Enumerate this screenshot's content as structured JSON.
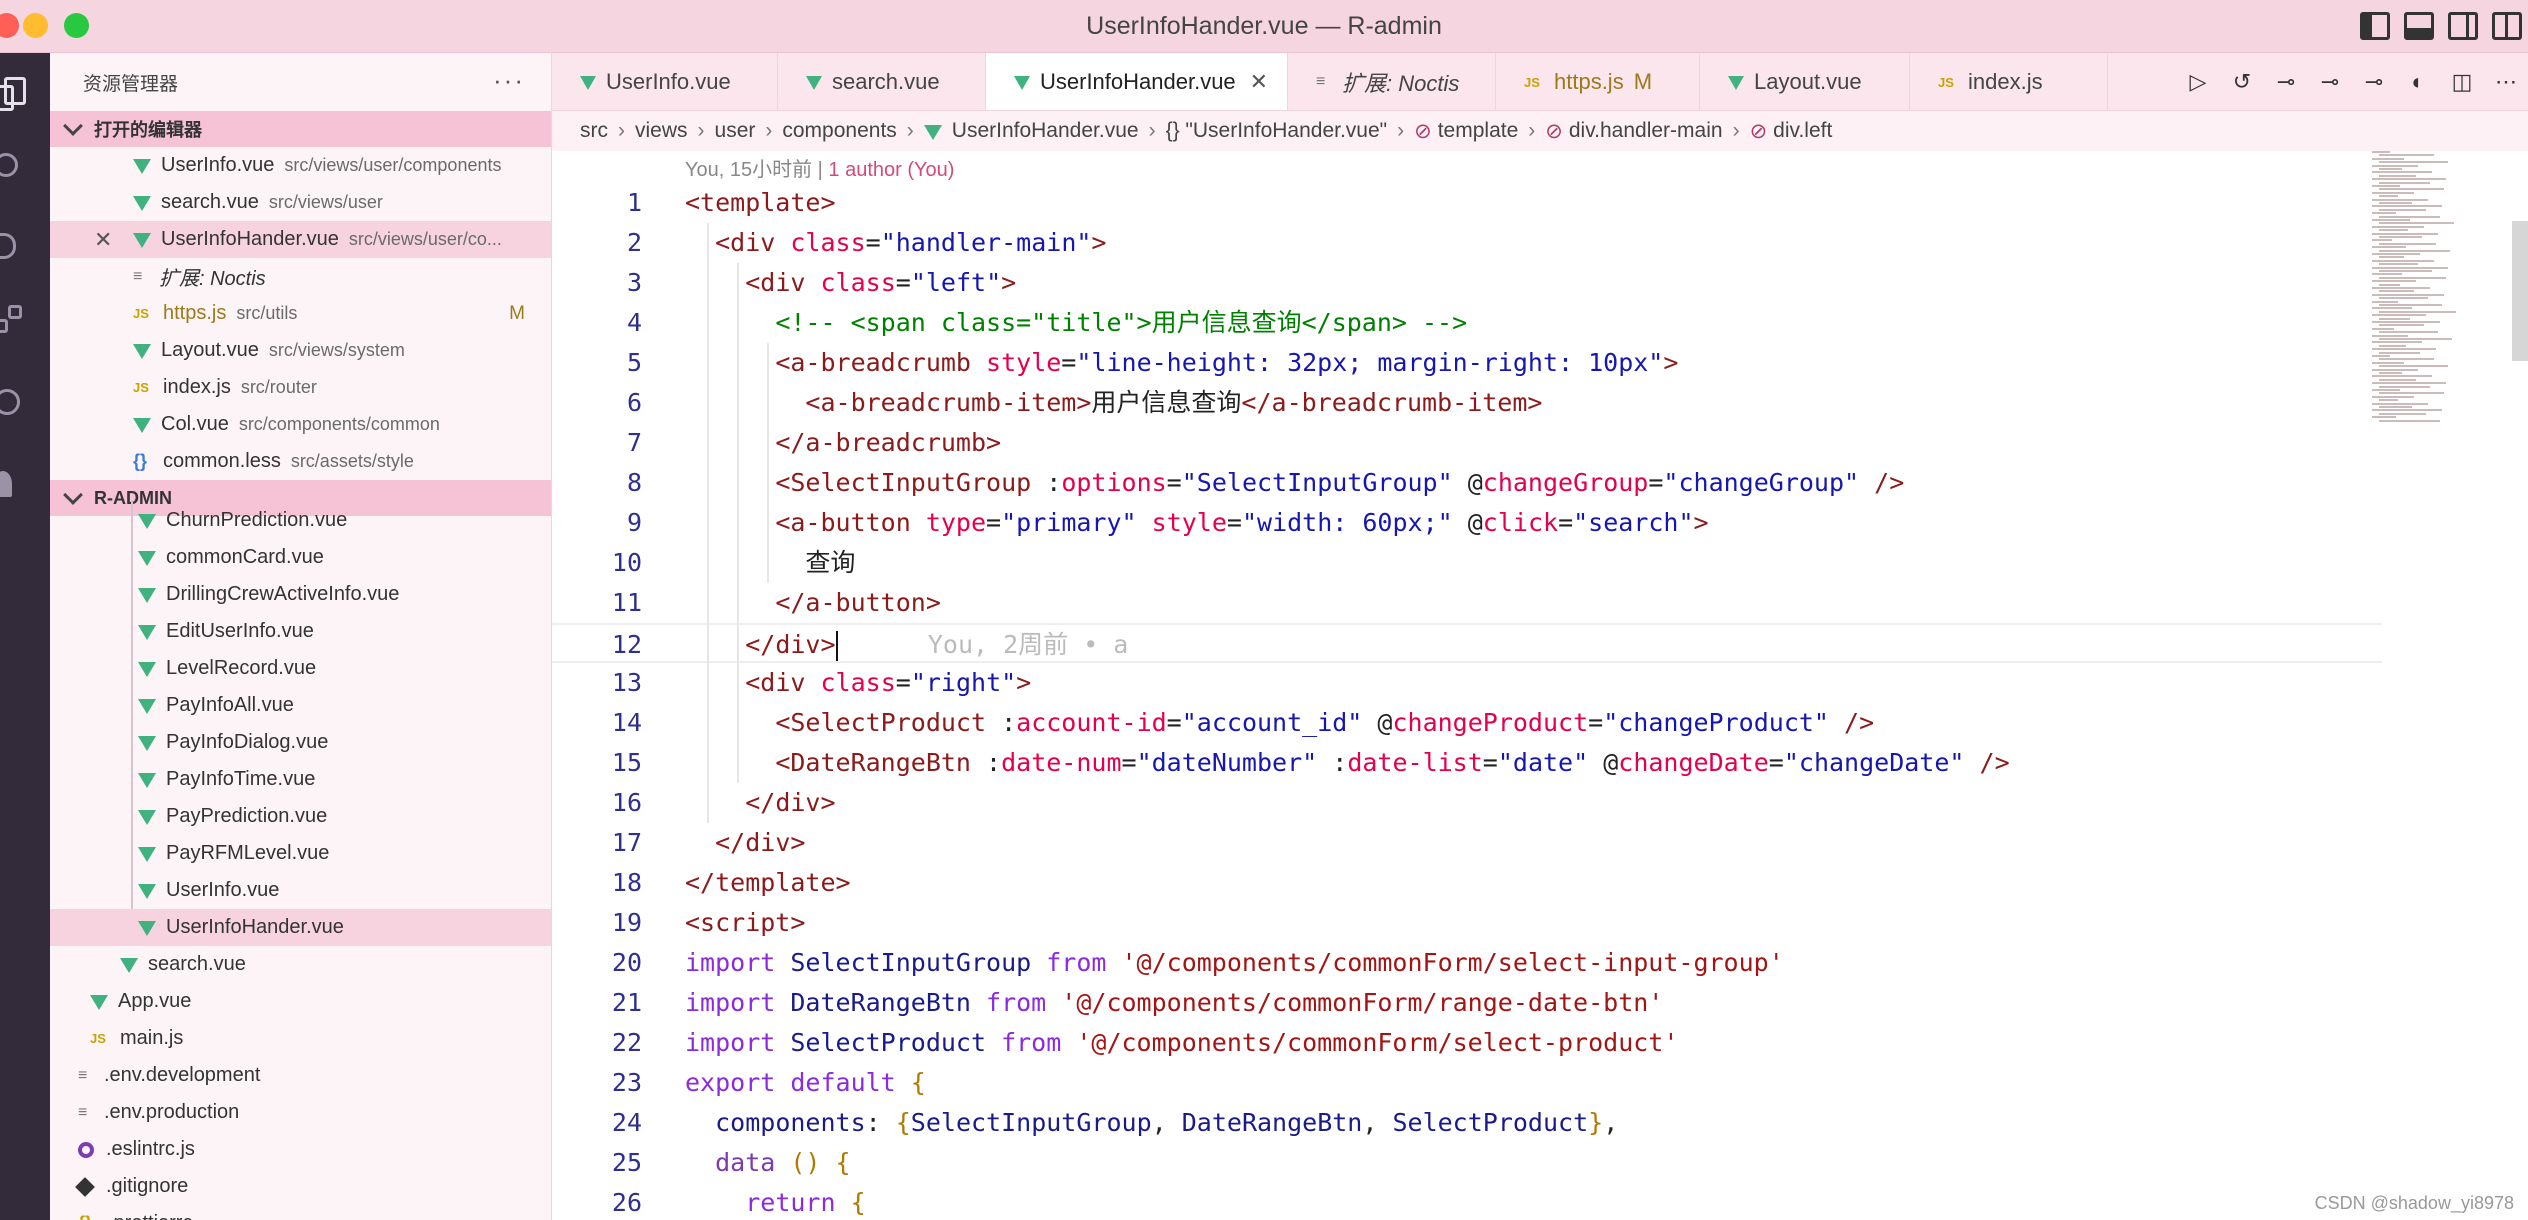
{
  "window": {
    "title": "UserInfoHander.vue — R-admin"
  },
  "sidebar": {
    "title": "资源管理器",
    "more": "···",
    "open_editors_header": "打开的编辑器",
    "open_editors": [
      {
        "name": "UserInfo.vue",
        "path": "src/views/user/components",
        "icon": "vue-icon"
      },
      {
        "name": "search.vue",
        "path": "src/views/user",
        "icon": "vue-icon"
      },
      {
        "name": "UserInfoHander.vue",
        "path": "src/views/user/co...",
        "icon": "vue-icon",
        "selected": true,
        "close": "✕"
      },
      {
        "name": "扩展: Noctis",
        "path": "",
        "icon": "extension-icon"
      },
      {
        "name": "https.js",
        "path": "src/utils",
        "icon": "js-icon",
        "badge": "M"
      },
      {
        "name": "Layout.vue",
        "path": "src/views/system",
        "icon": "vue-icon"
      },
      {
        "name": "index.js",
        "path": "src/router",
        "icon": "js-icon"
      },
      {
        "name": "Col.vue",
        "path": "src/components/common",
        "icon": "vue-icon"
      },
      {
        "name": "common.less",
        "path": "src/assets/style",
        "icon": "braces-icon"
      }
    ],
    "project_header": "R-ADMIN",
    "tree": [
      {
        "name": "ChurnPrediction.vue",
        "indent": 1
      },
      {
        "name": "commonCard.vue",
        "indent": 1
      },
      {
        "name": "DrillingCrewActiveInfo.vue",
        "indent": 1
      },
      {
        "name": "EditUserInfo.vue",
        "indent": 1
      },
      {
        "name": "LevelRecord.vue",
        "indent": 1
      },
      {
        "name": "PayInfoAll.vue",
        "indent": 1
      },
      {
        "name": "PayInfoDialog.vue",
        "indent": 1
      },
      {
        "name": "PayInfoTime.vue",
        "indent": 1
      },
      {
        "name": "PayPrediction.vue",
        "indent": 1
      },
      {
        "name": "PayRFMLevel.vue",
        "indent": 1
      },
      {
        "name": "UserInfo.vue",
        "indent": 1
      },
      {
        "name": "UserInfoHander.vue",
        "indent": 1,
        "selected": true
      },
      {
        "name": "search.vue",
        "indent": 2
      },
      {
        "name": "App.vue",
        "indent": 3
      },
      {
        "name": "main.js",
        "indent": 3
      },
      {
        "name": ".env.development",
        "indent": 4
      },
      {
        "name": ".env.production",
        "indent": 4
      },
      {
        "name": ".eslintrc.js",
        "indent": 4
      },
      {
        "name": ".gitignore",
        "indent": 4
      },
      {
        "name": ".prettierrc",
        "indent": 4
      }
    ]
  },
  "tabs": [
    {
      "label": "UserInfo.vue",
      "icon": "vue-icon"
    },
    {
      "label": "search.vue",
      "icon": "vue-icon"
    },
    {
      "label": "UserInfoHander.vue",
      "icon": "vue-icon",
      "active": true,
      "close": "✕"
    },
    {
      "label": "扩展: Noctis",
      "icon": "extension-icon"
    },
    {
      "label": "https.js",
      "icon": "js-icon",
      "mark": "M"
    },
    {
      "label": "Layout.vue",
      "icon": "vue-icon"
    },
    {
      "label": "index.js",
      "icon": "js-icon"
    }
  ],
  "breadcrumb": [
    "src",
    "views",
    "user",
    "components",
    "UserInfoHander.vue",
    "{} \"UserInfoHander.vue\"",
    "template",
    "div.handler-main",
    "div.left"
  ],
  "editor": {
    "codelens_prefix": "You, 15小时前 | ",
    "codelens_author": "1 author (You)",
    "ghost_blame": "You, 2周前 • a",
    "lines": [
      [
        [
          "t-tag",
          "<template>"
        ]
      ],
      [
        [
          "t-plain",
          "  "
        ],
        [
          "t-tag",
          "<div "
        ],
        [
          "t-attr",
          "class"
        ],
        [
          "t-plain",
          "="
        ],
        [
          "t-str",
          "\"handler-main\""
        ],
        [
          "t-tag",
          ">"
        ]
      ],
      [
        [
          "t-plain",
          "    "
        ],
        [
          "t-tag",
          "<div "
        ],
        [
          "t-attr",
          "class"
        ],
        [
          "t-plain",
          "="
        ],
        [
          "t-str",
          "\"left\""
        ],
        [
          "t-tag",
          ">"
        ]
      ],
      [
        [
          "t-plain",
          "      "
        ],
        [
          "t-cmt",
          "<!-- <span class=\"title\">用户信息查询</span> -->"
        ]
      ],
      [
        [
          "t-plain",
          "      "
        ],
        [
          "t-tag",
          "<a-breadcrumb "
        ],
        [
          "t-attr",
          "style"
        ],
        [
          "t-plain",
          "="
        ],
        [
          "t-str",
          "\"line-height: 32px; margin-right: 10px\""
        ],
        [
          "t-tag",
          ">"
        ]
      ],
      [
        [
          "t-plain",
          "        "
        ],
        [
          "t-tag",
          "<a-breadcrumb-item>"
        ],
        [
          "t-plain",
          "用户信息查询"
        ],
        [
          "t-tag",
          "</a-breadcrumb-item>"
        ]
      ],
      [
        [
          "t-plain",
          "      "
        ],
        [
          "t-tag",
          "</a-breadcrumb>"
        ]
      ],
      [
        [
          "t-plain",
          "      "
        ],
        [
          "t-tag",
          "<SelectInputGroup "
        ],
        [
          "t-plain",
          ":"
        ],
        [
          "t-attr",
          "options"
        ],
        [
          "t-plain",
          "="
        ],
        [
          "t-str",
          "\"SelectInputGroup\""
        ],
        [
          "t-plain",
          " @"
        ],
        [
          "t-attr",
          "changeGroup"
        ],
        [
          "t-plain",
          "="
        ],
        [
          "t-str",
          "\"changeGroup\""
        ],
        [
          "t-tag",
          " />"
        ]
      ],
      [
        [
          "t-plain",
          "      "
        ],
        [
          "t-tag",
          "<a-button "
        ],
        [
          "t-attr",
          "type"
        ],
        [
          "t-plain",
          "="
        ],
        [
          "t-str",
          "\"primary\""
        ],
        [
          "t-plain",
          " "
        ],
        [
          "t-attr",
          "style"
        ],
        [
          "t-plain",
          "="
        ],
        [
          "t-str",
          "\"width: 60px;\""
        ],
        [
          "t-plain",
          " @"
        ],
        [
          "t-attr",
          "click"
        ],
        [
          "t-plain",
          "="
        ],
        [
          "t-str",
          "\"search\""
        ],
        [
          "t-tag",
          ">"
        ]
      ],
      [
        [
          "t-plain",
          "        查询"
        ]
      ],
      [
        [
          "t-plain",
          "      "
        ],
        [
          "t-tag",
          "</a-button>"
        ]
      ],
      [
        [
          "t-plain",
          "    "
        ],
        [
          "t-tag",
          "</div>"
        ]
      ],
      [
        [
          "t-plain",
          "    "
        ],
        [
          "t-tag",
          "<div "
        ],
        [
          "t-attr",
          "class"
        ],
        [
          "t-plain",
          "="
        ],
        [
          "t-str",
          "\"right\""
        ],
        [
          "t-tag",
          ">"
        ]
      ],
      [
        [
          "t-plain",
          "      "
        ],
        [
          "t-tag",
          "<SelectProduct "
        ],
        [
          "t-plain",
          ":"
        ],
        [
          "t-attr",
          "account-id"
        ],
        [
          "t-plain",
          "="
        ],
        [
          "t-str",
          "\"account_id\""
        ],
        [
          "t-plain",
          " @"
        ],
        [
          "t-attr",
          "changeProduct"
        ],
        [
          "t-plain",
          "="
        ],
        [
          "t-str",
          "\"changeProduct\""
        ],
        [
          "t-tag",
          " />"
        ]
      ],
      [
        [
          "t-plain",
          "      "
        ],
        [
          "t-tag",
          "<DateRangeBtn "
        ],
        [
          "t-plain",
          ":"
        ],
        [
          "t-attr",
          "date-num"
        ],
        [
          "t-plain",
          "="
        ],
        [
          "t-str",
          "\"dateNumber\""
        ],
        [
          "t-plain",
          " :"
        ],
        [
          "t-attr",
          "date-list"
        ],
        [
          "t-plain",
          "="
        ],
        [
          "t-str",
          "\"date\""
        ],
        [
          "t-plain",
          " @"
        ],
        [
          "t-attr",
          "changeDate"
        ],
        [
          "t-plain",
          "="
        ],
        [
          "t-str",
          "\"changeDate\""
        ],
        [
          "t-tag",
          " />"
        ]
      ],
      [
        [
          "t-plain",
          "    "
        ],
        [
          "t-tag",
          "</div>"
        ]
      ],
      [
        [
          "t-plain",
          "  "
        ],
        [
          "t-tag",
          "</div>"
        ]
      ],
      [
        [
          "t-tag",
          "</template>"
        ]
      ],
      [
        [
          "t-tag",
          "<script>"
        ]
      ],
      [
        [
          "t-kw",
          "import "
        ],
        [
          "t-ident",
          "SelectInputGroup "
        ],
        [
          "t-kw",
          "from "
        ],
        [
          "t-path",
          "'@/components/commonForm/select-input-group'"
        ]
      ],
      [
        [
          "t-kw",
          "import "
        ],
        [
          "t-ident",
          "DateRangeBtn "
        ],
        [
          "t-kw",
          "from "
        ],
        [
          "t-path",
          "'@/components/commonForm/range-date-btn'"
        ]
      ],
      [
        [
          "t-kw",
          "import "
        ],
        [
          "t-ident",
          "SelectProduct "
        ],
        [
          "t-kw",
          "from "
        ],
        [
          "t-path",
          "'@/components/commonForm/select-product'"
        ]
      ],
      [
        [
          "t-kw",
          "export default "
        ],
        [
          "t-brk",
          "{"
        ]
      ],
      [
        [
          "t-plain",
          "  "
        ],
        [
          "t-ident",
          "components"
        ],
        [
          "t-plain",
          ": "
        ],
        [
          "t-brk",
          "{"
        ],
        [
          "t-ident",
          "SelectInputGroup"
        ],
        [
          "t-plain",
          ", "
        ],
        [
          "t-ident",
          "DateRangeBtn"
        ],
        [
          "t-plain",
          ", "
        ],
        [
          "t-ident",
          "SelectProduct"
        ],
        [
          "t-brk",
          "}"
        ],
        [
          "t-plain",
          ","
        ]
      ],
      [
        [
          "t-plain",
          "  "
        ],
        [
          "t-kw2",
          "data "
        ],
        [
          "t-brk",
          "() {"
        ]
      ],
      [
        [
          "t-plain",
          "    "
        ],
        [
          "t-kw",
          "return "
        ],
        [
          "t-brk",
          "{"
        ]
      ]
    ]
  },
  "watermark": "CSDN @shadow_yi8978"
}
